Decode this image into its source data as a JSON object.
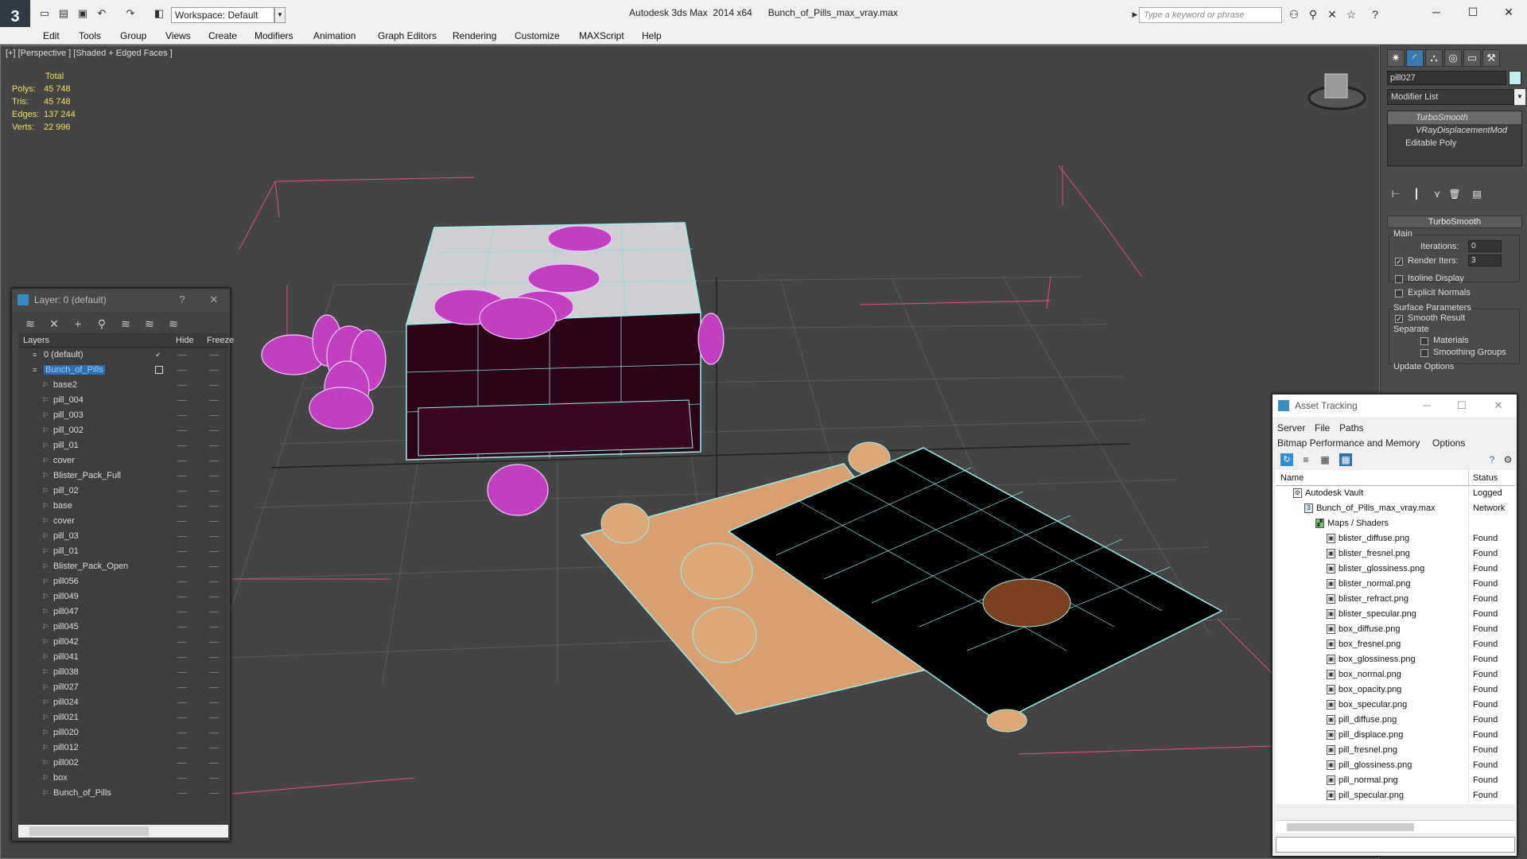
{
  "app": {
    "title": "Autodesk 3ds Max  2014 x64      Bunch_of_Pills_max_vray.max",
    "workspace": "Workspace: Default",
    "search_placeholder": "Type a keyword or phrase"
  },
  "menu": [
    "Edit",
    "Tools",
    "Group",
    "Views",
    "Create",
    "Modifiers",
    "Animation",
    "Graph Editors",
    "Rendering",
    "Customize",
    "MAXScript",
    "Help"
  ],
  "viewport": {
    "label": "[+] [Perspective ] [Shaded + Edged Faces ]",
    "stats": {
      "header": "Total",
      "rows": [
        {
          "label": "Polys:",
          "value": "45 748"
        },
        {
          "label": "Tris:",
          "value": "45 748"
        },
        {
          "label": "Edges:",
          "value": "137 244"
        },
        {
          "label": "Verts:",
          "value": "22 996"
        }
      ]
    }
  },
  "command_panel": {
    "object_name": "pill027",
    "object_color": "#bfeef0",
    "modifier_list": "Modifier List",
    "stack": [
      "TurboSmooth",
      "VRayDisplacementMod",
      "Editable Poly"
    ],
    "rollout_title": "TurboSmooth",
    "main_label": "Main",
    "iterations_label": "Iterations:",
    "iterations_value": "0",
    "render_iters_label": "Render Iters:",
    "render_iters_value": "3",
    "isoline_label": "Isoline Display",
    "explicit_normals_label": "Explicit Normals",
    "surface_params_label": "Surface Parameters",
    "smooth_result_label": "Smooth Result",
    "separate_label": "Separate",
    "materials_label": "Materials",
    "smoothing_groups_label": "Smoothing Groups",
    "update_options_label": "Update Options"
  },
  "layer_panel": {
    "title": "Layer: 0 (default)",
    "help": "?",
    "columns": {
      "layers": "Layers",
      "hide": "Hide",
      "freeze": "Freeze"
    },
    "rows": [
      {
        "name": "0 (default)",
        "level": 0
      },
      {
        "name": "Bunch_of_Pills",
        "level": 0
      },
      {
        "name": "base2",
        "level": 1
      },
      {
        "name": "pill_004",
        "level": 1
      },
      {
        "name": "pill_003",
        "level": 1
      },
      {
        "name": "pill_002",
        "level": 1
      },
      {
        "name": "pill_01",
        "level": 1
      },
      {
        "name": "cover",
        "level": 1
      },
      {
        "name": "Blister_Pack_Full",
        "level": 1
      },
      {
        "name": "pill_02",
        "level": 1
      },
      {
        "name": "base",
        "level": 1
      },
      {
        "name": "cover",
        "level": 1
      },
      {
        "name": "pill_03",
        "level": 1
      },
      {
        "name": "pill_01",
        "level": 1
      },
      {
        "name": "Blister_Pack_Open",
        "level": 1
      },
      {
        "name": "pill056",
        "level": 1
      },
      {
        "name": "pill049",
        "level": 1
      },
      {
        "name": "pill047",
        "level": 1
      },
      {
        "name": "pill045",
        "level": 1
      },
      {
        "name": "pill042",
        "level": 1
      },
      {
        "name": "pill041",
        "level": 1
      },
      {
        "name": "pill038",
        "level": 1
      },
      {
        "name": "pill027",
        "level": 1
      },
      {
        "name": "pill024",
        "level": 1
      },
      {
        "name": "pill021",
        "level": 1
      },
      {
        "name": "pill020",
        "level": 1
      },
      {
        "name": "pill012",
        "level": 1
      },
      {
        "name": "pill002",
        "level": 1
      },
      {
        "name": "box",
        "level": 1
      },
      {
        "name": "Bunch_of_Pills",
        "level": 1
      }
    ]
  },
  "asset_panel": {
    "title": "Asset Tracking",
    "menu1": [
      "Server",
      "File",
      "Paths"
    ],
    "menu2": [
      "Bitmap Performance and Memory",
      "Options"
    ],
    "columns": {
      "name": "Name",
      "status": "Status"
    },
    "rows": [
      {
        "name": "Autodesk Vault",
        "status": "Logged",
        "level": 1
      },
      {
        "name": "Bunch_of_Pills_max_vray.max",
        "status": "Network",
        "level": 2
      },
      {
        "name": "Maps / Shaders",
        "status": "",
        "level": 3
      },
      {
        "name": "blister_diffuse.png",
        "status": "Found",
        "level": 4
      },
      {
        "name": "blister_fresnel.png",
        "status": "Found",
        "level": 4
      },
      {
        "name": "blister_glossiness.png",
        "status": "Found",
        "level": 4
      },
      {
        "name": "blister_normal.png",
        "status": "Found",
        "level": 4
      },
      {
        "name": "blister_refract.png",
        "status": "Found",
        "level": 4
      },
      {
        "name": "blister_specular.png",
        "status": "Found",
        "level": 4
      },
      {
        "name": "box_diffuse.png",
        "status": "Found",
        "level": 4
      },
      {
        "name": "box_fresnel.png",
        "status": "Found",
        "level": 4
      },
      {
        "name": "box_glossiness.png",
        "status": "Found",
        "level": 4
      },
      {
        "name": "box_normal.png",
        "status": "Found",
        "level": 4
      },
      {
        "name": "box_opacity.png",
        "status": "Found",
        "level": 4
      },
      {
        "name": "box_specular.png",
        "status": "Found",
        "level": 4
      },
      {
        "name": "pill_diffuse.png",
        "status": "Found",
        "level": 4
      },
      {
        "name": "pill_displace.png",
        "status": "Found",
        "level": 4
      },
      {
        "name": "pill_fresnel.png",
        "status": "Found",
        "level": 4
      },
      {
        "name": "pill_glossiness.png",
        "status": "Found",
        "level": 4
      },
      {
        "name": "pill_normal.png",
        "status": "Found",
        "level": 4
      },
      {
        "name": "pill_specular.png",
        "status": "Found",
        "level": 4
      }
    ]
  }
}
